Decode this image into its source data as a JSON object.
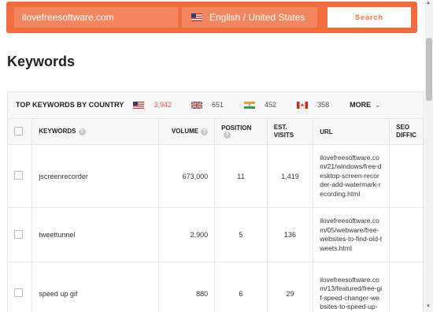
{
  "search": {
    "domain_value": "ilovefreesoftware.com",
    "language_label": "English / United States",
    "search_label": "Search"
  },
  "page": {
    "title": "Keywords"
  },
  "countries": {
    "label": "TOP KEYWORDS BY COUNTRY",
    "items": [
      {
        "flag": "us-flag",
        "count": "3,942",
        "color": "#e05a4f"
      },
      {
        "flag": "uk-flag",
        "count": "651",
        "color": "#555555"
      },
      {
        "flag": "india-flag",
        "count": "452",
        "color": "#555555"
      },
      {
        "flag": "canada-flag",
        "count": "358",
        "color": "#555555"
      }
    ],
    "more_label": "MORE"
  },
  "table": {
    "headers": {
      "keywords": "KEYWORDS",
      "volume": "VOLUME",
      "position": "POSITION",
      "est_visits_1": "EST.",
      "est_visits_2": "VISITS",
      "url": "URL",
      "seo_1": "SEO",
      "seo_2": "DIFFIC"
    },
    "rows": [
      {
        "keyword": "jscreenrecorder",
        "volume": "673,000",
        "position": "11",
        "visits": "1,419",
        "url": "ilovefreesoftware.com/21/windows/free-desktop-screen-recorder-add-watermark-recording.html"
      },
      {
        "keyword": "tweettunnel",
        "volume": "2,900",
        "position": "5",
        "visits": "136",
        "url": "ilovefreesoftware.com/05/webware/free-websites-to-find-old-tweets.html"
      },
      {
        "keyword": "speed up gif",
        "volume": "880",
        "position": "6",
        "visits": "29",
        "url": "ilovefreesoftware.com/13/featured/free-gif-speed-changer-websites-to-speed-up-"
      }
    ]
  },
  "colors": {
    "accent": "#f26d3d",
    "accent_light": "#f3865f",
    "us_count": "#e05a4f"
  }
}
